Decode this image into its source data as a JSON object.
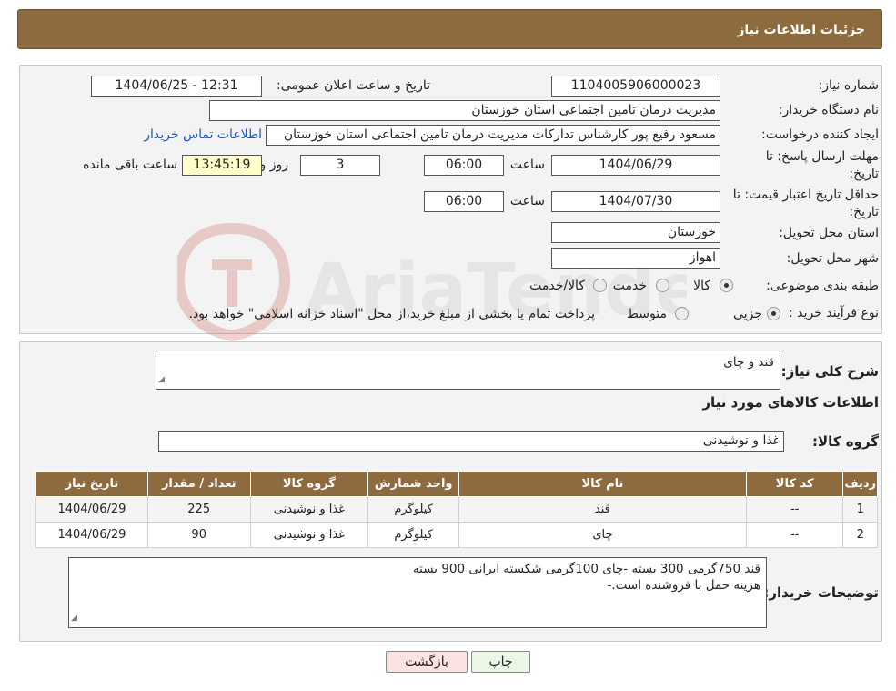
{
  "header": {
    "title": "جزئیات اطلاعات نیاز"
  },
  "form": {
    "need_number_label": "شماره نیاز:",
    "need_number": "1104005906000023",
    "announce_label": "تاریخ و ساعت اعلان عمومی:",
    "announce_value": "1404/06/25 - 12:31",
    "buyer_org_label": "نام دستگاه خریدار:",
    "buyer_org": "مدیریت درمان تامین اجتماعی استان خوزستان",
    "creator_label": "ایجاد کننده درخواست:",
    "creator": "مسعود رفیع پور کارشناس تدارکات مدیریت درمان تامین اجتماعی استان خوزستان",
    "contact_link": "اطلاعات تماس خریدار",
    "deadline_label_1": "مهلت ارسال پاسخ: تا",
    "deadline_label_2": "تاریخ:",
    "deadline_date": "1404/06/29",
    "time_label": "ساعت",
    "deadline_time": "06:00",
    "days_value": "3",
    "days_label": "روز و",
    "remaining_time": "13:45:19",
    "remaining_label": "ساعت باقی مانده",
    "validity_label_1": "حداقل تاریخ اعتبار قیمت: تا",
    "validity_label_2": "تاریخ:",
    "validity_date": "1404/07/30",
    "validity_time": "06:00",
    "province_label": "استان محل تحویل:",
    "province": "خوزستان",
    "city_label": "شهر محل تحویل:",
    "city": "اهواز",
    "category_label": "طبقه بندی موضوعی:",
    "category_options": [
      "کالا",
      "خدمت",
      "کالا/خدمت"
    ],
    "process_label": "نوع فرآیند خرید :",
    "process_options": [
      "جزیی",
      "متوسط"
    ],
    "process_note": "پرداخت تمام یا بخشی از مبلغ خرید،از محل \"اسناد خزانه اسلامی\" خواهد بود."
  },
  "details": {
    "summary_label": "شرح کلی نیاز:",
    "summary": "قند و چای",
    "goods_info_title": "اطلاعات کالاهای مورد نیاز",
    "group_label": "گروه کالا:",
    "group_value": "غذا و نوشیدنی",
    "table": {
      "headers": [
        "ردیف",
        "کد کالا",
        "نام کالا",
        "واحد شمارش",
        "گروه کالا",
        "تعداد / مقدار",
        "تاریخ نیاز"
      ],
      "rows": [
        [
          "1",
          "--",
          "قند",
          "کیلوگرم",
          "غذا و نوشیدنی",
          "225",
          "1404/06/29"
        ],
        [
          "2",
          "--",
          "چای",
          "کیلوگرم",
          "غذا و نوشیدنی",
          "90",
          "1404/06/29"
        ]
      ]
    },
    "notes_label": "توضیحات خریدار:",
    "notes_line1": "قند 750گرمی 300 بسته -چای 100گرمی شکسته ایرانی  900 بسته",
    "notes_line2": "هزینه حمل با فروشنده است.-"
  },
  "buttons": {
    "print": "چاپ",
    "back": "بازگشت"
  },
  "colors": {
    "header_bg": "#8e6b3e",
    "link": "#1a55c8",
    "back_button_bg": "#fde2e2",
    "print_button_bg": "#eaf7e6"
  }
}
